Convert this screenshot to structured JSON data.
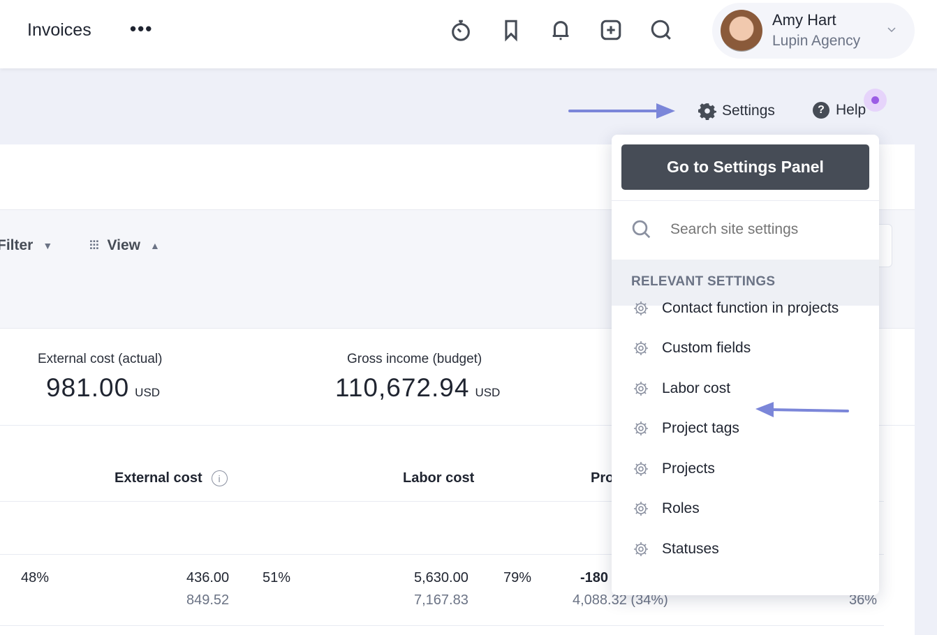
{
  "header": {
    "title": "Invoices",
    "more_icon": "ellipsis-icon",
    "icons": [
      "stopwatch-icon",
      "bookmark-icon",
      "bell-icon",
      "plus-square-icon",
      "search-icon"
    ],
    "user": {
      "name": "Amy Hart",
      "org": "Lupin Agency"
    }
  },
  "subbar": {
    "settings": "Settings",
    "help": "Help"
  },
  "toolbar": {
    "filter": "Filter",
    "view": "View"
  },
  "kpis": [
    {
      "label": "External cost (actual)",
      "value": "981.00",
      "unit": "USD"
    },
    {
      "label": "Gross income (budget)",
      "value": "110,672.94",
      "unit": "USD"
    }
  ],
  "table": {
    "headers": [
      "External cost",
      "Labor cost",
      "Pro"
    ],
    "row": {
      "c1": "48%",
      "ext": "436.00",
      "ext_sub": "849.52",
      "ext_pct": "51%",
      "labor": "5,630.00",
      "labor_sub": "7,167.83",
      "labor_pct": "79%",
      "profit": "-180",
      "profit_sub": "4,088.32 (34%)",
      "last_sub": "36%"
    }
  },
  "dropdown": {
    "button": "Go to Settings Panel",
    "search_placeholder": "Search site settings",
    "section": "RELEVANT SETTINGS",
    "items": [
      "Contact function in projects",
      "Custom fields",
      "Labor cost",
      "Project tags",
      "Projects",
      "Roles",
      "Statuses"
    ]
  },
  "colors": {
    "accent_arrow": "#7b86d9",
    "button_dark": "#464c56",
    "notification_dot": "#9b5de5"
  }
}
